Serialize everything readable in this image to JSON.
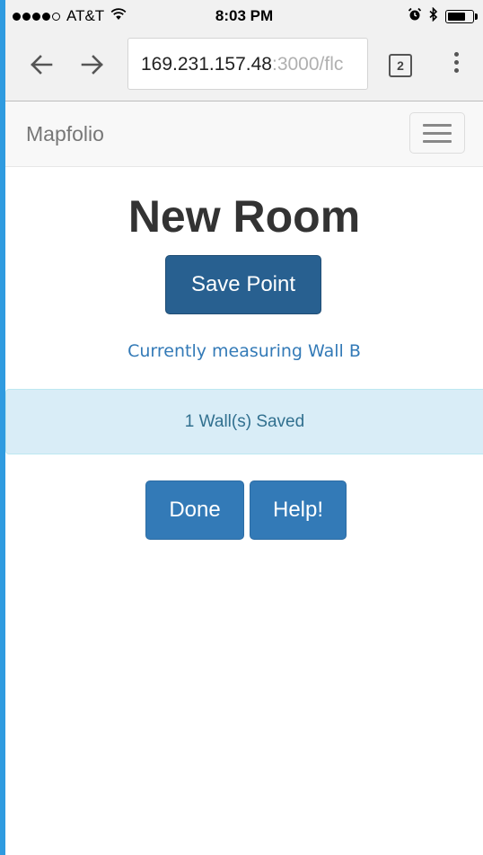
{
  "status_bar": {
    "carrier": "AT&T",
    "time": "8:03 PM",
    "signal_bars_filled": 4,
    "signal_bars_total": 5,
    "battery_level": 0.8
  },
  "browser": {
    "url_host": "169.231.157.48",
    "url_rest": ":3000/flc",
    "tab_count": "2",
    "icons": {
      "back": "arrow-left-icon",
      "forward": "arrow-right-icon",
      "menu": "more-vertical-icon"
    }
  },
  "navbar": {
    "brand": "Mapfolio",
    "menu_icon": "hamburger-icon"
  },
  "main": {
    "title": "New Room",
    "save_button": "Save Point",
    "status_text": "Currently measuring Wall B",
    "alert_text": "1 Wall(s) Saved",
    "done_button": "Done",
    "help_button": "Help!"
  },
  "colors": {
    "primary": "#337ab7",
    "primary_active": "#286090",
    "info_bg": "#d9edf7",
    "info_text": "#31708f",
    "edge_blue": "#2f9be0"
  }
}
